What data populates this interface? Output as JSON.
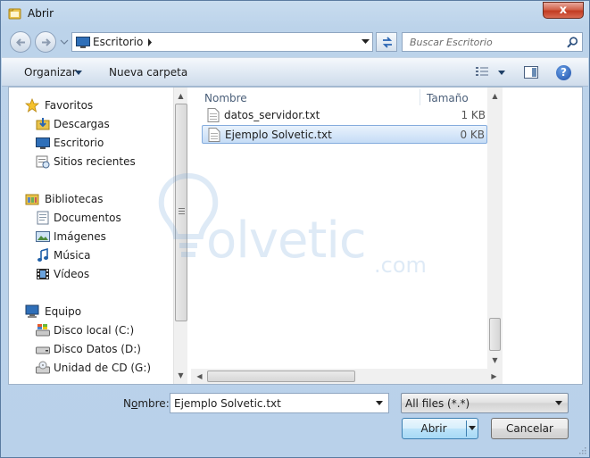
{
  "window": {
    "title": "Abrir",
    "close_label": "x"
  },
  "address": {
    "crumb": "Escritorio"
  },
  "search": {
    "placeholder": "Buscar Escritorio"
  },
  "toolbar": {
    "organize_label": "Organizar",
    "new_folder_label": "Nueva carpeta",
    "help_label": "?"
  },
  "nav": {
    "favorites": {
      "label": "Favoritos",
      "icon": "star-icon",
      "items": [
        {
          "label": "Descargas",
          "icon": "downloads-folder-icon"
        },
        {
          "label": "Escritorio",
          "icon": "desktop-icon"
        },
        {
          "label": "Sitios recientes",
          "icon": "recent-places-icon"
        }
      ]
    },
    "libraries": {
      "label": "Bibliotecas",
      "icon": "libraries-icon",
      "items": [
        {
          "label": "Documentos",
          "icon": "documents-icon"
        },
        {
          "label": "Imágenes",
          "icon": "pictures-icon"
        },
        {
          "label": "Música",
          "icon": "music-icon"
        },
        {
          "label": "Vídeos",
          "icon": "videos-icon"
        }
      ]
    },
    "computer": {
      "label": "Equipo",
      "icon": "computer-icon",
      "items": [
        {
          "label": "Disco local (C:)",
          "icon": "local-disk-icon"
        },
        {
          "label": "Disco Datos (D:)",
          "icon": "data-disk-icon"
        },
        {
          "label": "Unidad de CD (G:)",
          "icon": "cd-drive-icon"
        }
      ]
    }
  },
  "files": {
    "columns": {
      "name": "Nombre",
      "size": "Tamaño"
    },
    "rows": [
      {
        "name": "datos_servidor.txt",
        "size": "1 KB",
        "selected": false
      },
      {
        "name": "Ejemplo Solvetic.txt",
        "size": "0 KB",
        "selected": true
      }
    ]
  },
  "watermark": {
    "text": "olvetic",
    "suffix": ".com"
  },
  "bottom": {
    "filename_label_pre": "N",
    "filename_label_u": "o",
    "filename_label_post": "mbre:",
    "filename_value": "Ejemplo Solvetic.txt",
    "filter_value": "All files (*.*)",
    "open_label": "Abrir",
    "cancel_label": "Cancelar"
  },
  "colors": {
    "accent": "#84acdd",
    "selection": "#c5dcf6",
    "frame": "#b9d1ea"
  }
}
